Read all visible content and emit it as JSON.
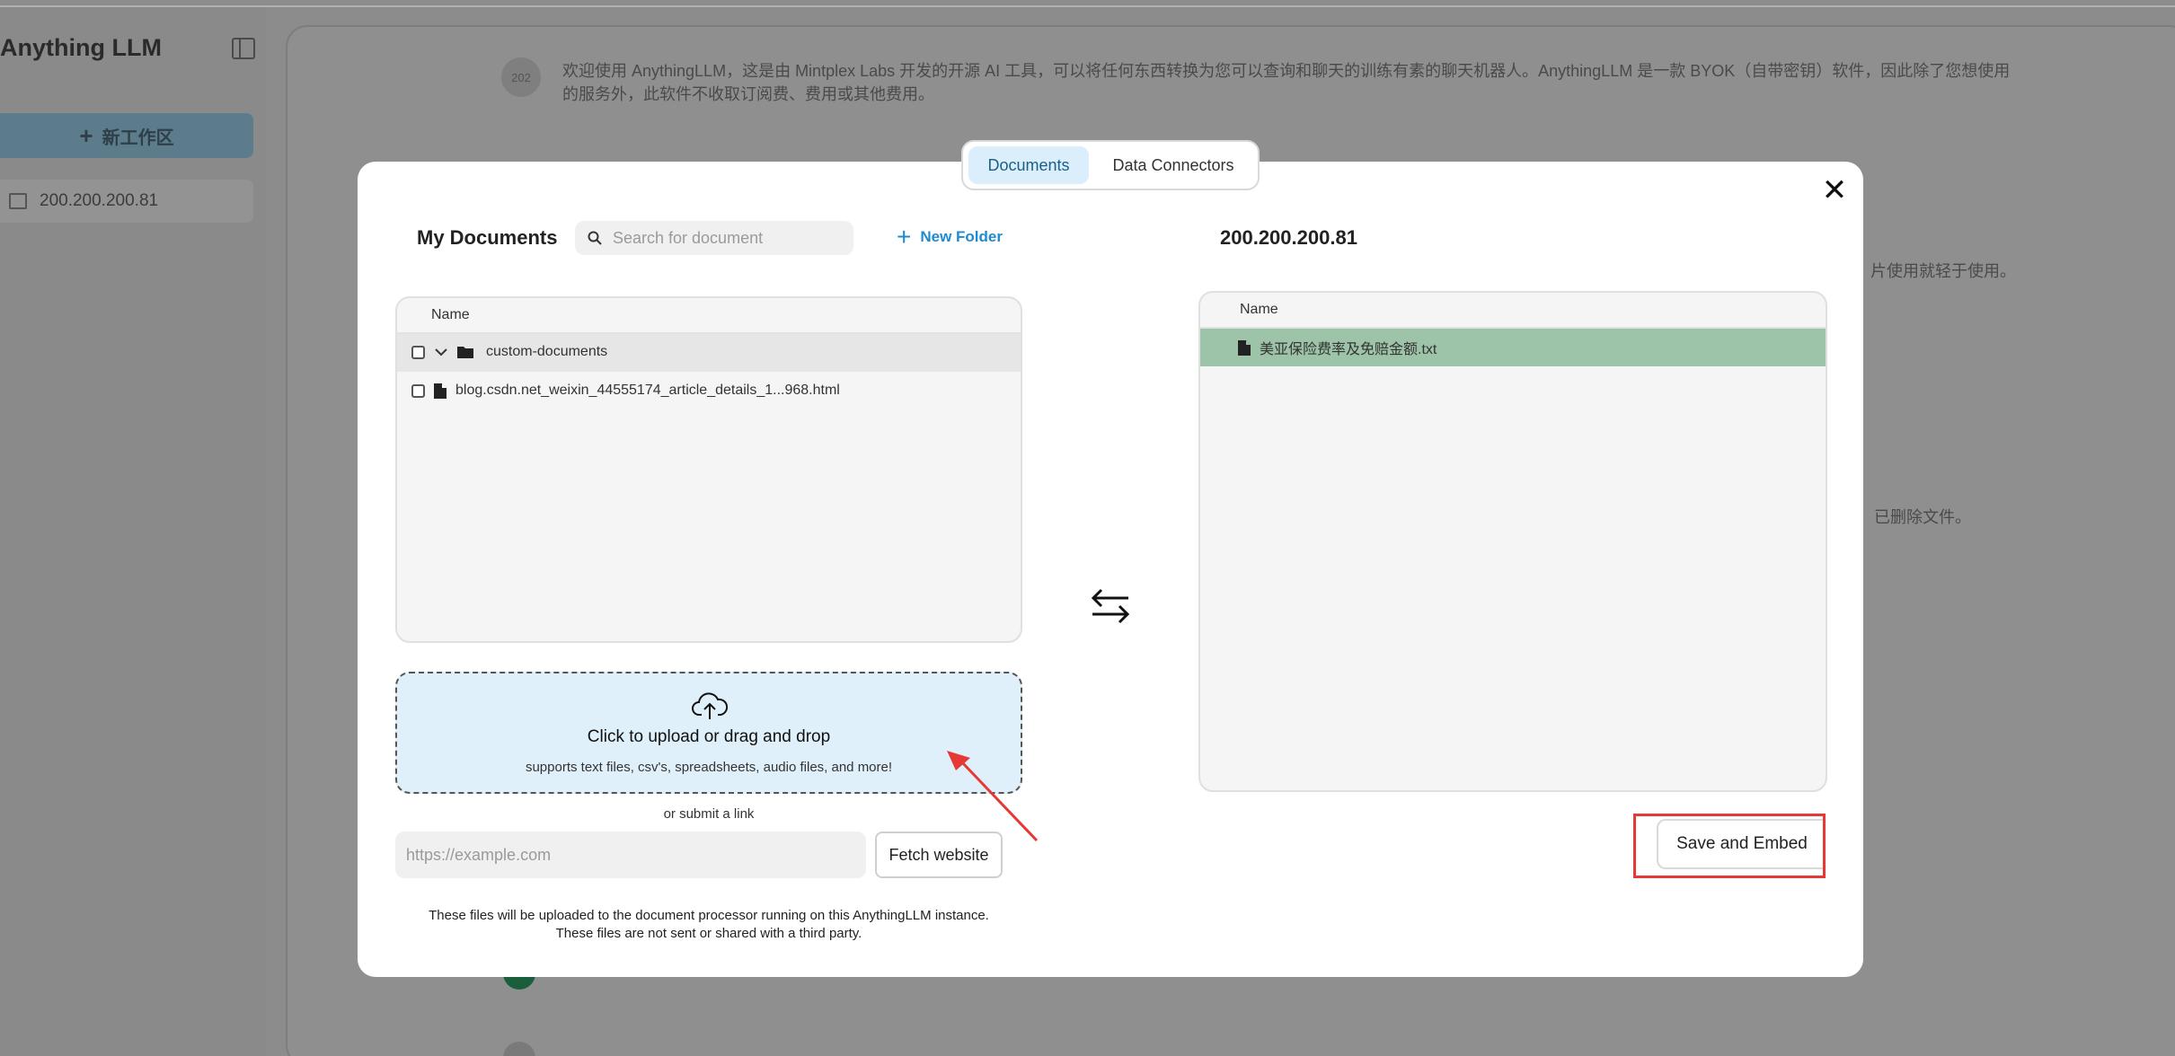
{
  "app": {
    "logo": "Anything LLM",
    "new_workspace_label": "新工作区",
    "workspace_name": "200.200.200.81"
  },
  "background_chat": {
    "avatar_label": "202",
    "welcome_text": "欢迎使用 AnythingLLM，这是由 Mintplex Labs 开发的开源 AI 工具，可以将任何东西转换为您可以查询和聊天的训练有素的聊天机器人。AnythingLLM 是一款 BYOK（自带密钥）软件，因此除了您想使用的服务外，此软件不收取订阅费、费用或其他费用。",
    "fragment_1": "片使用就轻于使用。",
    "fragment_2": "已删除文件。"
  },
  "modal": {
    "tabs": [
      {
        "label": "Documents",
        "active": true
      },
      {
        "label": "Data Connectors",
        "active": false
      }
    ],
    "close_icon": "close-icon",
    "my_documents": {
      "title": "My Documents",
      "search_placeholder": "Search for document",
      "new_folder_label": "New Folder",
      "column_header": "Name",
      "rows": [
        {
          "name": "custom-documents",
          "type": "folder"
        },
        {
          "name": "blog.csdn.net_weixin_44555174_article_details_1...968.html",
          "type": "file"
        }
      ]
    },
    "upload": {
      "title": "Click to upload or drag and drop",
      "subtitle": "supports text files, csv's, spreadsheets, audio files, and more!",
      "or_link": "or submit a link",
      "url_placeholder": "https://example.com",
      "fetch_label": "Fetch website",
      "disclaimer_line1": "These files will be uploaded to the document processor running on this AnythingLLM instance.",
      "disclaimer_line2": "These files are not sent or shared with a third party."
    },
    "workspace": {
      "title": "200.200.200.81",
      "column_header": "Name",
      "rows": [
        {
          "name": "美亚保险费率及免赔金额.txt",
          "type": "file"
        }
      ]
    },
    "save_label": "Save and Embed"
  },
  "colors": {
    "accent": "#1e8bd0",
    "tab_active_bg": "#dbeefb",
    "upload_bg": "#e0f0fa",
    "workspace_row_bg": "#9dc4a8",
    "annotation_red": "#e53935"
  }
}
